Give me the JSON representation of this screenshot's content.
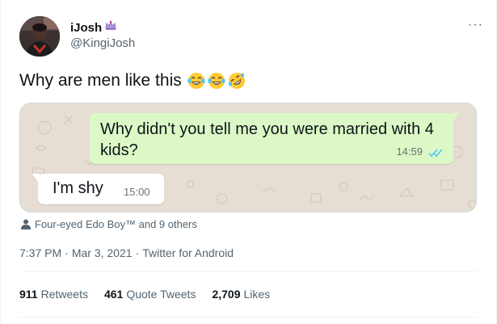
{
  "author": {
    "name": "iJosh",
    "handle": "@KingiJosh",
    "badge_icon": "tiara-icon"
  },
  "tweet": {
    "text": "Why are men like this",
    "emojis": [
      "tears-of-joy",
      "tears-of-joy",
      "rolling-on-floor-laughing"
    ]
  },
  "chat": {
    "sent_message": "Why didn't you tell me you were married with 4 kids?",
    "sent_time": "14:59",
    "received_message": "I'm shy",
    "received_time": "15:00",
    "colors": {
      "sent_bubble": "#dcf8c6",
      "received_bubble": "#ffffff",
      "wallpaper": "#e6ddd3",
      "read_ticks": "#4fc3f7"
    }
  },
  "social_context": {
    "text": "Four-eyed Edo Boy™ and 9 others",
    "icon": "person-icon"
  },
  "meta": {
    "time": "7:37 PM",
    "separator": "·",
    "date": "Mar 3, 2021",
    "source": "Twitter for Android"
  },
  "stats": [
    {
      "value": "911",
      "label": "Retweets"
    },
    {
      "value": "461",
      "label": "Quote Tweets"
    },
    {
      "value": "2,709",
      "label": "Likes"
    }
  ]
}
